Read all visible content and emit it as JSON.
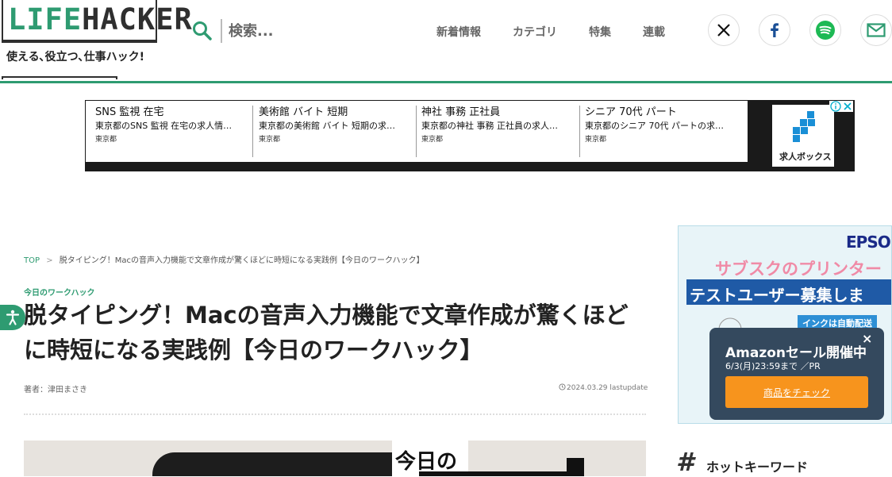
{
  "header": {
    "logo": {
      "part1": "LIFE",
      "part2": "HACKER"
    },
    "tagline": "使える､役立つ､仕事ハック!",
    "search_placeholder": "検索...",
    "nav": [
      "新着情報",
      "カテゴリ",
      "特集",
      "連載"
    ],
    "social_icons": [
      "x-icon",
      "facebook-icon",
      "spotify-icon",
      "mail-icon"
    ],
    "accent_color": "#2e9b71"
  },
  "ad_banner": {
    "items": [
      {
        "title": "SNS 監視 在宅",
        "desc": "東京都のSNS 監視 在宅の求人情…",
        "loc": "東京都"
      },
      {
        "title": "美術館 バイト 短期",
        "desc": "東京都の美術館 バイト 短期の求…",
        "loc": "東京都"
      },
      {
        "title": "神社 事務 正社員",
        "desc": "東京都の神社 事務 正社員の求人…",
        "loc": "東京都"
      },
      {
        "title": "シニア 70代 パート",
        "desc": "東京都のシニア 70代 パートの求…",
        "loc": "東京都"
      }
    ],
    "logo_text": "求人ボックス"
  },
  "breadcrumb": {
    "home": "TOP",
    "sep": ">",
    "current": "脱タイピング！Macの音声入力機能で文章作成が驚くほどに時短になる実践例【今日のワークハック】"
  },
  "article": {
    "category": "今日のワークハック",
    "title": "脱タイピング！Macの音声入力機能で文章作成が驚くほどに時短になる実践例【今日のワークハック】",
    "author": "著者：津田まさき",
    "date": "2024.03.29 lastupdate",
    "hero_text": "今日の"
  },
  "side_ad": {
    "brand": "EPSON",
    "line1": "サブスクのプリンター",
    "line2": "テストユーザー募集しま",
    "line3": "インクは自動配送"
  },
  "popup": {
    "title": "Amazonセール開催中",
    "subtitle": "6/3(月)23:59まで ／PR",
    "button": "商品をチェック",
    "close": "×"
  },
  "hot_keywords": {
    "hash": "#",
    "title": "ホットキーワード"
  }
}
